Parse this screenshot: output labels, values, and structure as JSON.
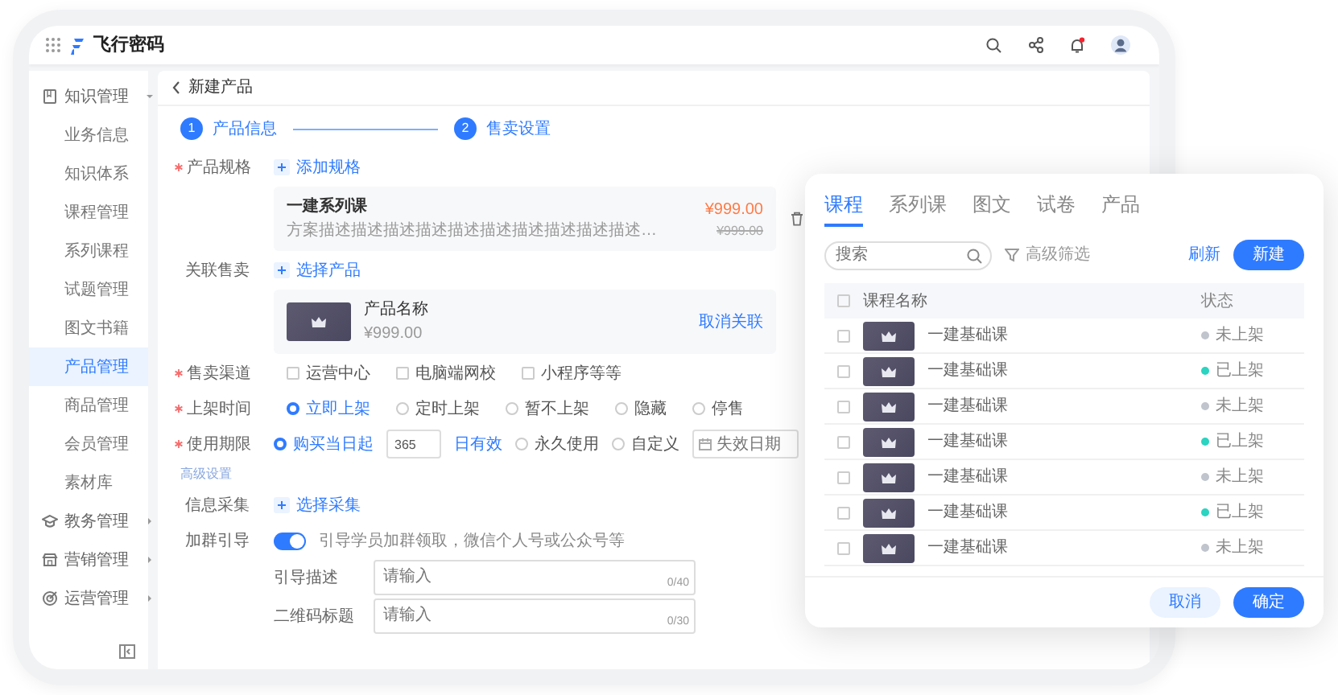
{
  "header": {
    "logo": "飞行密码"
  },
  "sidebar": {
    "items": [
      {
        "label": "知识管理",
        "expanded": true,
        "children": [
          {
            "label": "业务信息",
            "selected": false
          },
          {
            "label": "知识体系",
            "selected": false
          },
          {
            "label": "课程管理",
            "selected": false
          },
          {
            "label": "系列课程",
            "selected": false
          },
          {
            "label": "试题管理",
            "selected": false
          },
          {
            "label": "图文书籍",
            "selected": false
          },
          {
            "label": "产品管理",
            "selected": true
          },
          {
            "label": "商品管理",
            "selected": false
          },
          {
            "label": "会员管理",
            "selected": false
          },
          {
            "label": "素材库",
            "selected": false
          }
        ]
      },
      {
        "label": "教务管理",
        "expanded": false
      },
      {
        "label": "营销管理",
        "expanded": false
      },
      {
        "label": "运营管理",
        "expanded": false
      }
    ]
  },
  "page": {
    "title": "新建产品",
    "steps": [
      {
        "number": "1",
        "label": "产品信息"
      },
      {
        "number": "2",
        "label": "售卖设置"
      }
    ],
    "rows": [
      {
        "kind": "spec",
        "label": "产品规格",
        "required": true,
        "action": "添加规格",
        "items": [
          {
            "name": "一建系列课",
            "description": "方案描述描述描述描述描述描述描述描述描述描述…",
            "price": "¥999.00",
            "original_price": "¥999.00"
          }
        ]
      },
      {
        "kind": "related",
        "label": "关联售卖",
        "required": false,
        "action": "选择产品",
        "items": [
          {
            "name": "产品名称",
            "price": "¥999.00",
            "action": "取消关联"
          }
        ]
      },
      {
        "kind": "checkboxes",
        "label": "售卖渠道",
        "required": true,
        "options": [
          {
            "label": "运营中心",
            "checked": false
          },
          {
            "label": "电脑端网校",
            "checked": false
          },
          {
            "label": "小程序等等",
            "checked": false
          }
        ]
      },
      {
        "kind": "radios",
        "label": "上架时间",
        "required": true,
        "options": [
          {
            "label": "立即上架",
            "selected": true
          },
          {
            "label": "定时上架",
            "selected": false
          },
          {
            "label": "暂不上架",
            "selected": false
          },
          {
            "label": "隐藏",
            "selected": false
          },
          {
            "label": "停售",
            "selected": false
          }
        ]
      },
      {
        "kind": "period",
        "label": "使用期限",
        "required": true,
        "options": [
          {
            "label": "购买当日起",
            "selected": true,
            "value": "365",
            "suffix": "日有效"
          },
          {
            "label": "永久使用",
            "selected": false
          },
          {
            "label": "自定义",
            "selected": false,
            "placeholder": "失效日期"
          }
        ]
      },
      {
        "kind": "link",
        "label": "高级设置"
      },
      {
        "kind": "action",
        "label": "信息采集",
        "required": false,
        "action": "选择采集"
      },
      {
        "kind": "toggle",
        "label": "加群引导",
        "required": false,
        "on": true,
        "hint": "引导学员加群领取，微信个人号或公众号等"
      },
      {
        "kind": "textarea",
        "label": "引导描述",
        "placeholder": "请输入",
        "counter": "0/40"
      },
      {
        "kind": "textarea",
        "label": "二维码标题",
        "placeholder": "请输入",
        "counter": "0/30"
      }
    ]
  },
  "dialog": {
    "tabs": [
      {
        "label": "课程",
        "selected": true
      },
      {
        "label": "系列课",
        "selected": false
      },
      {
        "label": "图文",
        "selected": false
      },
      {
        "label": "试卷",
        "selected": false
      },
      {
        "label": "产品",
        "selected": false
      }
    ],
    "search": {
      "placeholder": "搜索"
    },
    "filter": "高级筛选",
    "refresh": "刷新",
    "create": "新建",
    "header_checked": false,
    "columns": [
      "课程名称",
      "状态"
    ],
    "rows": [
      {
        "name": "一建基础课",
        "status": "未上架",
        "color": "#c0c4cc",
        "checked": false
      },
      {
        "name": "一建基础课",
        "status": "已上架",
        "color": "#2ad4c0",
        "checked": false
      },
      {
        "name": "一建基础课",
        "status": "未上架",
        "color": "#c0c4cc",
        "checked": false
      },
      {
        "name": "一建基础课",
        "status": "已上架",
        "color": "#2ad4c0",
        "checked": false
      },
      {
        "name": "一建基础课",
        "status": "未上架",
        "color": "#c0c4cc",
        "checked": false
      },
      {
        "name": "一建基础课",
        "status": "已上架",
        "color": "#2ad4c0",
        "checked": false
      },
      {
        "name": "一建基础课",
        "status": "未上架",
        "color": "#c0c4cc",
        "checked": false
      }
    ],
    "buttons": [
      {
        "label": "取消",
        "primary": false
      },
      {
        "label": "确定",
        "primary": true
      }
    ]
  }
}
